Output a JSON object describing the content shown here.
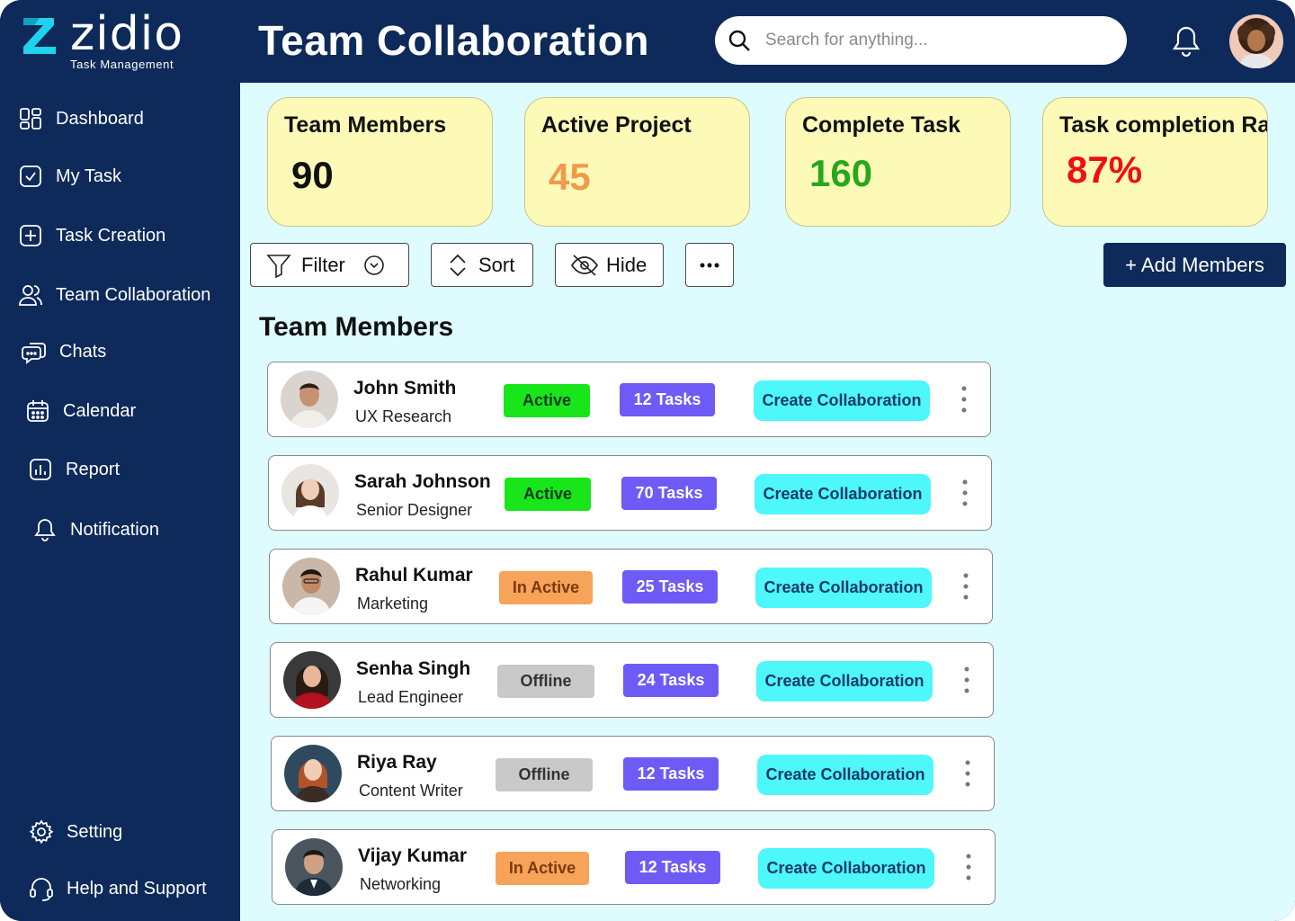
{
  "brand": {
    "name": "zidio",
    "tagline": "Task Management",
    "accent": "#1fd3ee"
  },
  "header": {
    "title": "Team Collaboration"
  },
  "search": {
    "placeholder": "Search for anything..."
  },
  "sidebar": {
    "items": [
      {
        "label": "Dashboard",
        "icon": "dashboard-icon"
      },
      {
        "label": "My Task",
        "icon": "check-square-icon"
      },
      {
        "label": "Task Creation",
        "icon": "plus-square-icon"
      },
      {
        "label": "Team Collaboration",
        "icon": "users-icon"
      },
      {
        "label": "Chats",
        "icon": "chat-icon"
      },
      {
        "label": "Calendar",
        "icon": "calendar-icon"
      },
      {
        "label": "Report",
        "icon": "report-icon"
      },
      {
        "label": "Notification",
        "icon": "bell-icon"
      }
    ],
    "bottom": [
      {
        "label": "Setting",
        "icon": "gear-icon"
      },
      {
        "label": "Help and Support",
        "icon": "headset-icon"
      }
    ]
  },
  "stats": [
    {
      "label": "Team Members",
      "value": "90",
      "color": "#111111"
    },
    {
      "label": "Active Project",
      "value": "45",
      "color": "#f2994a"
    },
    {
      "label": "Complete Task",
      "value": "160",
      "color": "#25a81a"
    },
    {
      "label": "Task completion Rate",
      "value": "87%",
      "color": "#f01010"
    }
  ],
  "toolbar": {
    "filter": "Filter",
    "sort": "Sort",
    "hide": "Hide",
    "add_members": "+ Add Members"
  },
  "section": {
    "title": "Team Members"
  },
  "members": [
    {
      "name": "John Smith",
      "role": "UX Research",
      "status": "Active",
      "tasks": "12 Tasks",
      "action": "Create Collaboration"
    },
    {
      "name": "Sarah Johnson",
      "role": "Senior Designer",
      "status": "Active",
      "tasks": "70 Tasks",
      "action": "Create Collaboration"
    },
    {
      "name": "Rahul Kumar",
      "role": "Marketing",
      "status": "In Active",
      "tasks": "25 Tasks",
      "action": "Create Collaboration"
    },
    {
      "name": "Senha Singh",
      "role": "Lead Engineer",
      "status": "Offline",
      "tasks": "24 Tasks",
      "action": "Create Collaboration"
    },
    {
      "name": "Riya Ray",
      "role": "Content Writer",
      "status": "Offline",
      "tasks": "12 Tasks",
      "action": "Create Collaboration"
    },
    {
      "name": "Vijay Kumar",
      "role": "Networking",
      "status": "In Active",
      "tasks": "12 Tasks",
      "action": "Create Collaboration"
    }
  ],
  "status_colors": {
    "Active": "#18e61a",
    "In Active": "#f7a35a",
    "Offline": "#c9c9c9"
  }
}
